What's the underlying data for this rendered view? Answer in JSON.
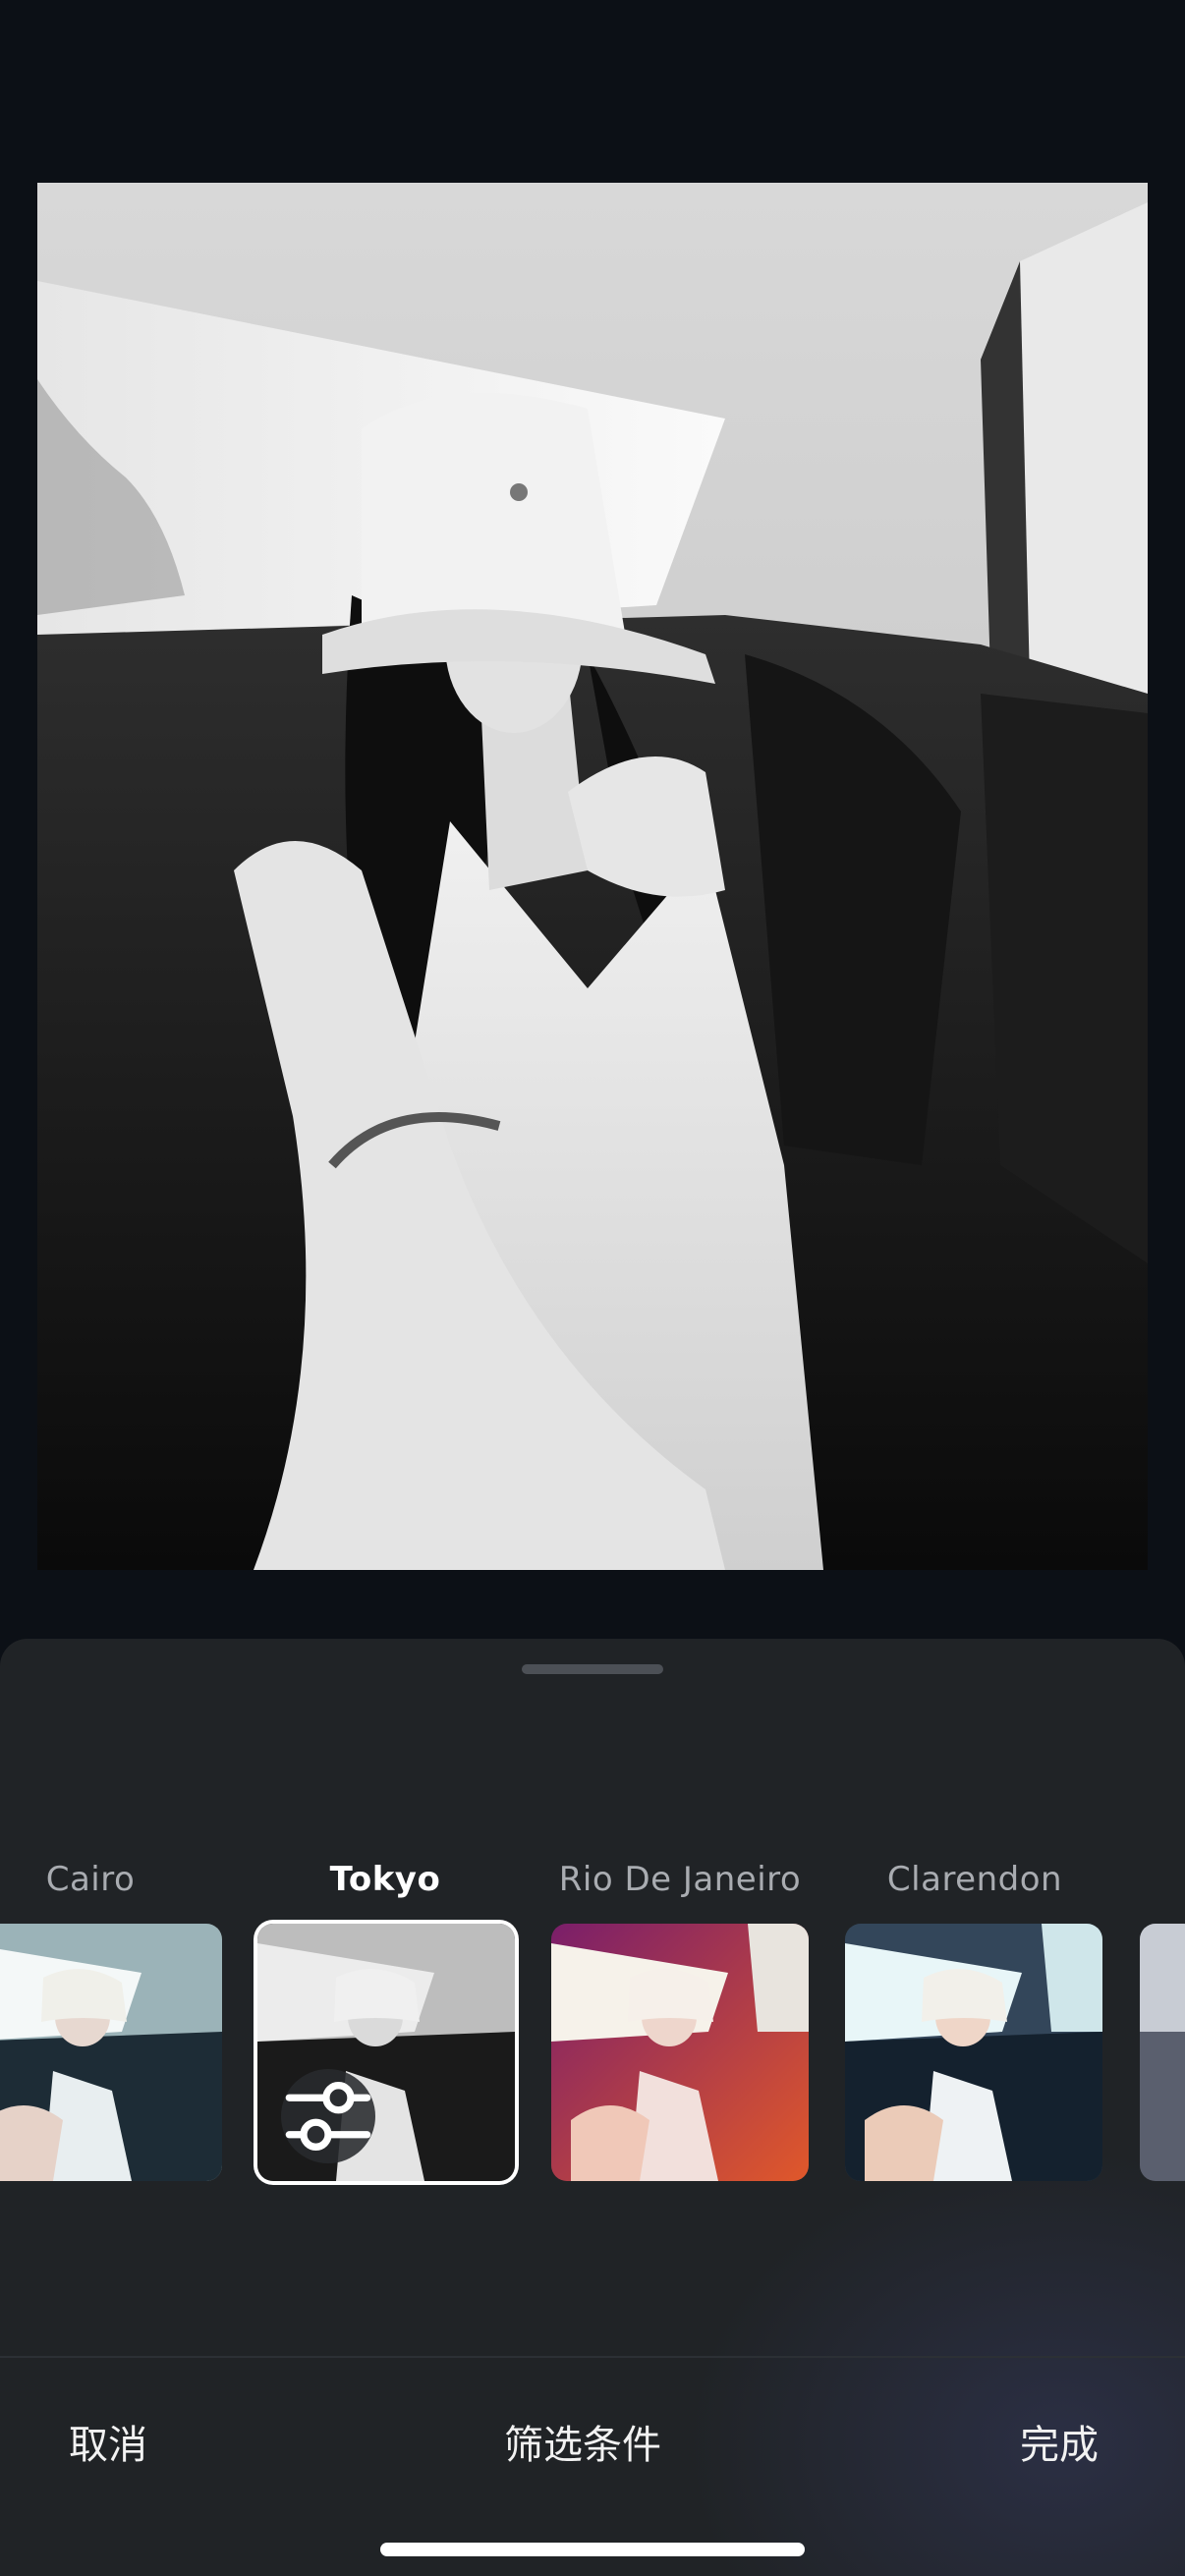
{
  "filters": [
    {
      "name": "Cairo",
      "selected": false
    },
    {
      "name": "Tokyo",
      "selected": true
    },
    {
      "name": "Rio De Janeiro",
      "selected": false
    },
    {
      "name": "Clarendon",
      "selected": false
    }
  ],
  "bottom_bar": {
    "cancel_label": "取消",
    "title": "筛选条件",
    "done_label": "完成"
  },
  "icons": {
    "adjust": "sliders-icon"
  }
}
